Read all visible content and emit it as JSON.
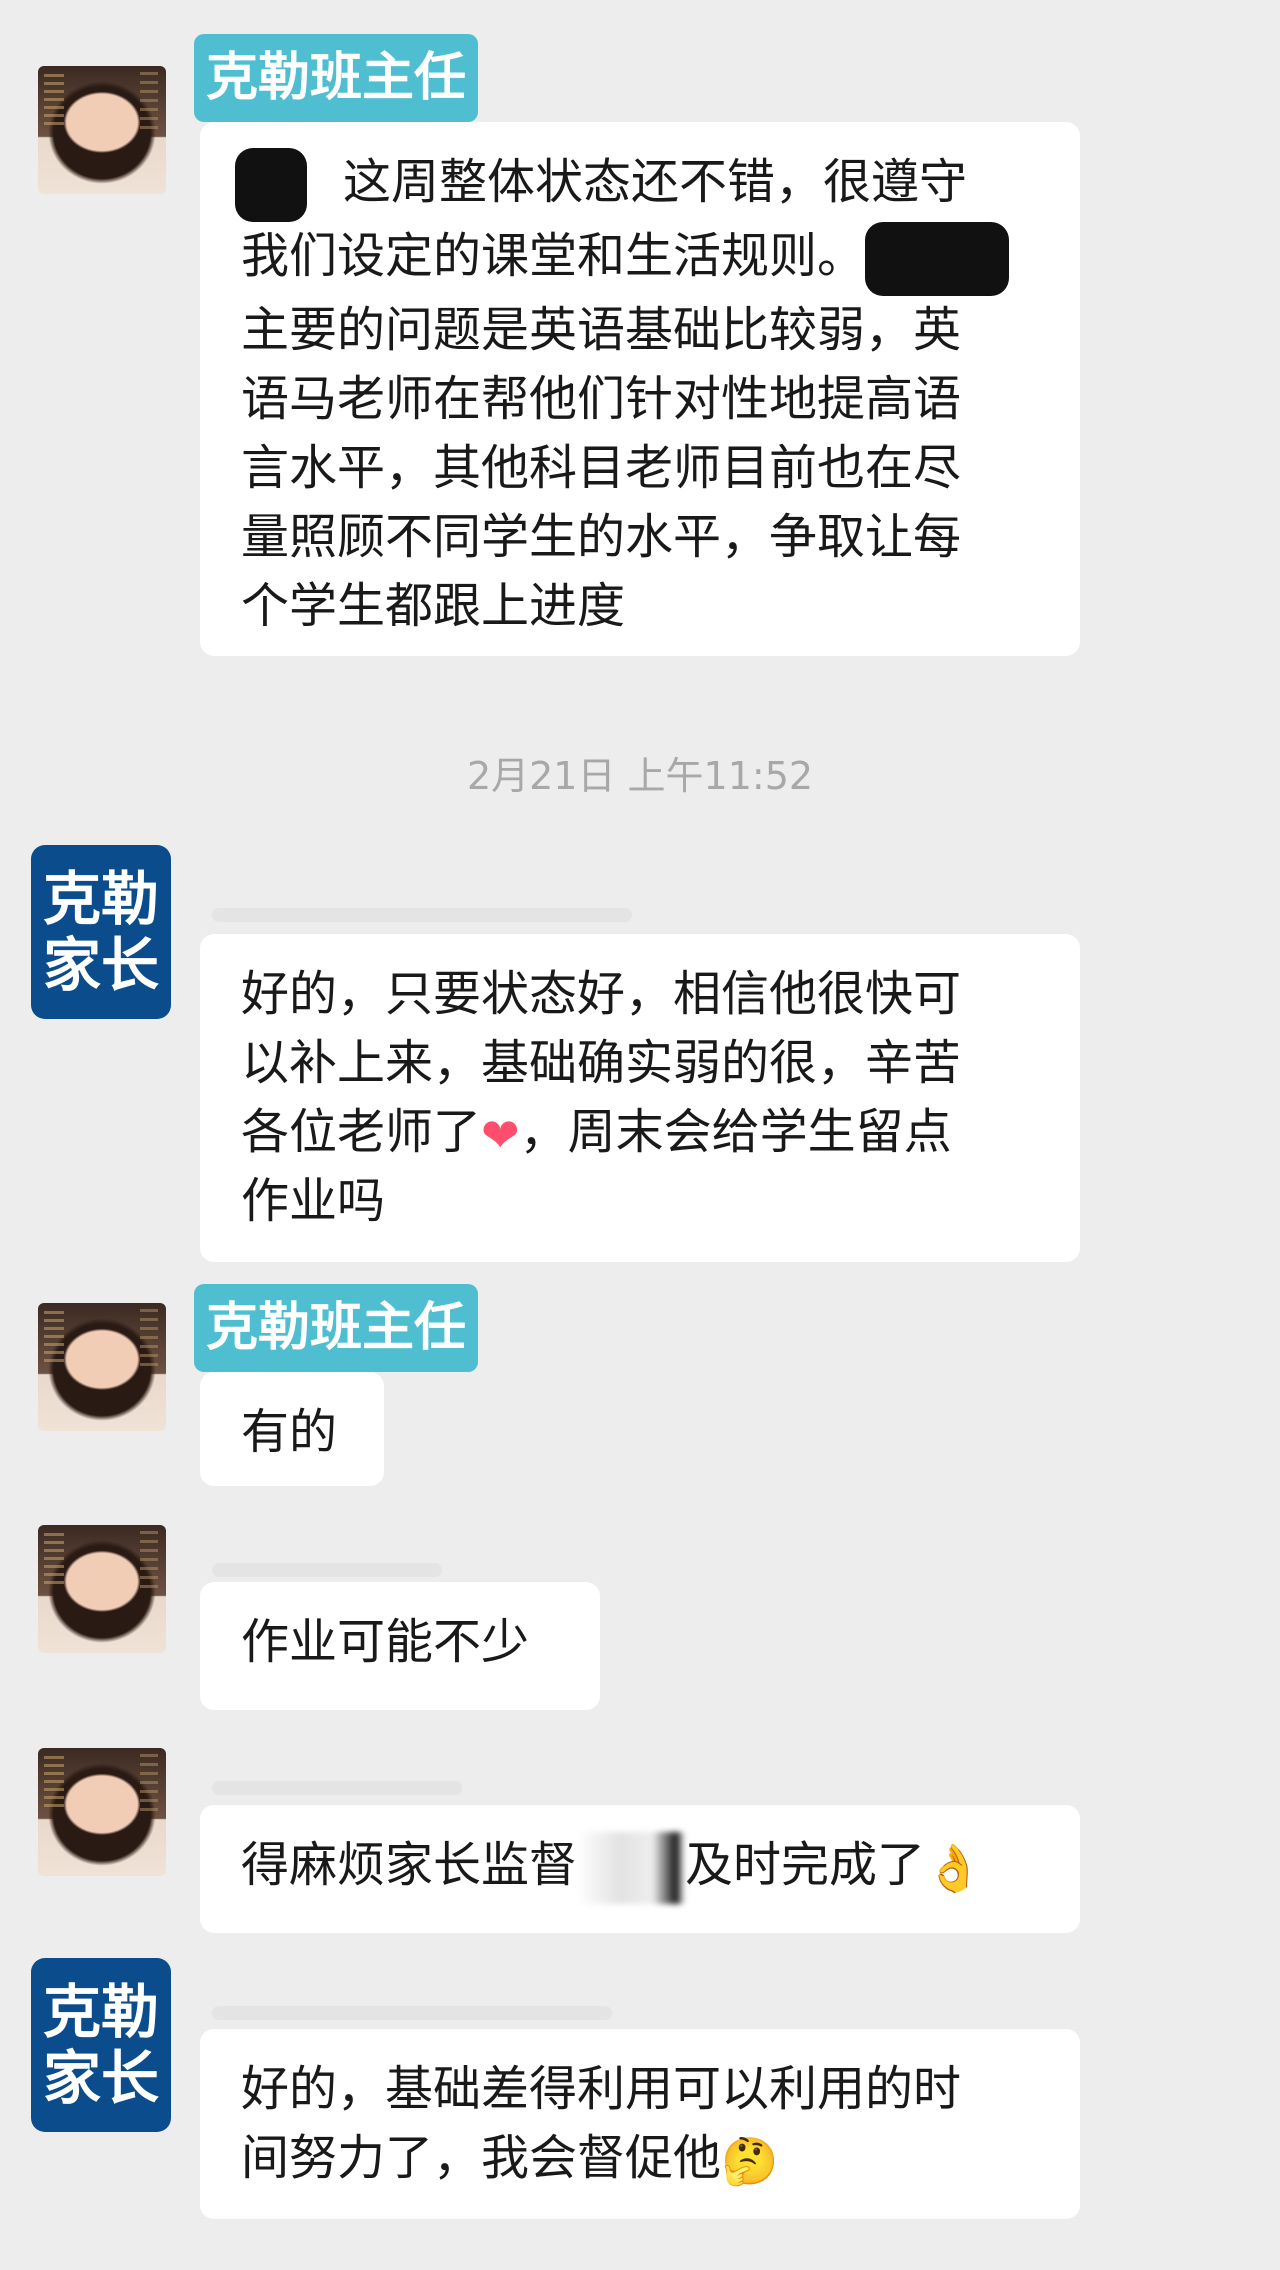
{
  "names": {
    "teacher": "克勒班主任",
    "parent_logo_line1": "克勒",
    "parent_logo_line2": "家长"
  },
  "messages": {
    "m1": {
      "line1": "这周整体状态还不错，很遵守",
      "line2": "我们设定的课堂和生活规则。",
      "line3": "主要的问题是英语基础比较弱，英",
      "line4": "语马老师在帮他们针对性地提高语",
      "line5": "言水平，其他科目老师目前也在尽",
      "line6": "量照顾不同学生的水平，争取让每",
      "line7": "个学生都跟上进度"
    },
    "timestamp": "2月21日 上午11:52",
    "m2": {
      "line1": "好的，只要状态好，相信他很快可",
      "line2": "以补上来，基础确实弱的很，辛苦",
      "line3a": "各位老师了",
      "line3b": "，周末会给学生留点",
      "line4": "作业吗"
    },
    "m3": {
      "text": "有的"
    },
    "m4": {
      "text": "作业可能不少"
    },
    "m5": {
      "text_a": "得麻烦家长监督",
      "text_b": "及时完成了"
    },
    "m6": {
      "line1": "好的，基础差得利用可以利用的时",
      "line2": "间努力了，我会督促他"
    }
  },
  "emoji": {
    "heart": "❤",
    "pinched_hand": "👌",
    "thinking_face": "🤔"
  },
  "icons": [
    "teacher-avatar",
    "parent-logo-avatar",
    "heart-emoji",
    "hand-emoji",
    "thinking-face-emoji"
  ],
  "colors": {
    "background": "#ededed",
    "bubble": "#ffffff",
    "name_tag": "#4ebed0",
    "parent_logo": "#0b4c8c",
    "timestamp": "#a8a8a8"
  }
}
